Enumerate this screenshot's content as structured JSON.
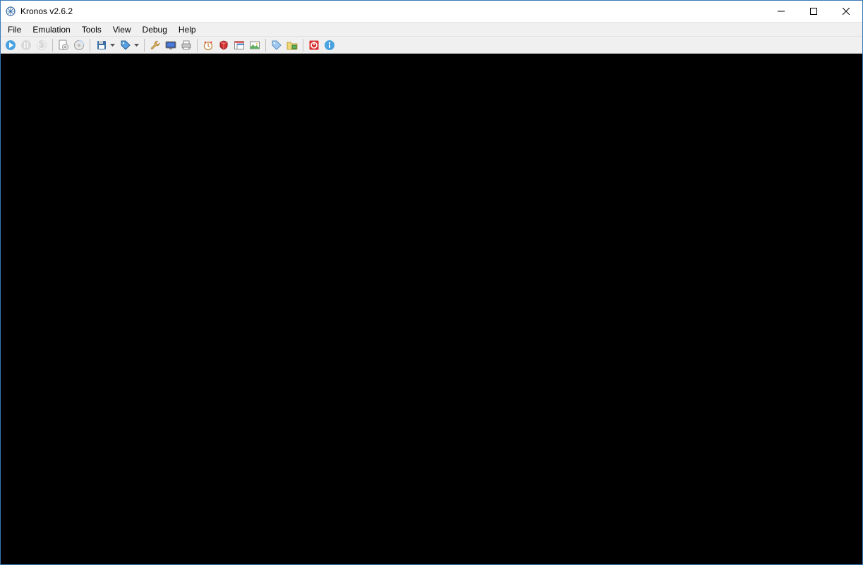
{
  "window": {
    "title": "Kronos v2.6.2"
  },
  "menubar": {
    "items": [
      "File",
      "Emulation",
      "Tools",
      "View",
      "Debug",
      "Help"
    ]
  },
  "toolbar": {
    "groups": [
      [
        {
          "name": "run-icon",
          "tip": "Run",
          "kind": "play-blue"
        },
        {
          "name": "pause-icon",
          "tip": "Pause",
          "kind": "pause-gray",
          "disabled": true
        },
        {
          "name": "reset-icon",
          "tip": "Reset",
          "kind": "reset-gray",
          "disabled": true
        }
      ],
      [
        {
          "name": "open-cd-icon",
          "tip": "Open CD",
          "kind": "cd-doc"
        },
        {
          "name": "open-iso-icon",
          "tip": "Open ISO",
          "kind": "cd"
        }
      ],
      [
        {
          "name": "save-state-icon",
          "tip": "Save State",
          "kind": "floppy",
          "dropdown": true
        },
        {
          "name": "load-state-icon",
          "tip": "Load State",
          "kind": "tag",
          "dropdown": true
        }
      ],
      [
        {
          "name": "settings-icon",
          "tip": "Settings",
          "kind": "wrench"
        },
        {
          "name": "fullscreen-icon",
          "tip": "Fullscreen",
          "kind": "monitor"
        },
        {
          "name": "printer-icon",
          "tip": "Print",
          "kind": "printer"
        }
      ],
      [
        {
          "name": "clock-icon",
          "tip": "Frame Limiter",
          "kind": "alarm"
        },
        {
          "name": "cheats-icon",
          "tip": "Cheats",
          "kind": "box-red"
        },
        {
          "name": "layer-icon",
          "tip": "Layers",
          "kind": "window"
        },
        {
          "name": "screenshot-icon",
          "tip": "Screenshot",
          "kind": "picture"
        }
      ],
      [
        {
          "name": "memory-icon",
          "tip": "Memory Transfer",
          "kind": "tag2"
        },
        {
          "name": "backup-icon",
          "tip": "Backup Manager",
          "kind": "folder-mem"
        }
      ],
      [
        {
          "name": "quit-icon",
          "tip": "Quit",
          "kind": "power"
        },
        {
          "name": "about-icon",
          "tip": "About",
          "kind": "info"
        }
      ]
    ]
  }
}
